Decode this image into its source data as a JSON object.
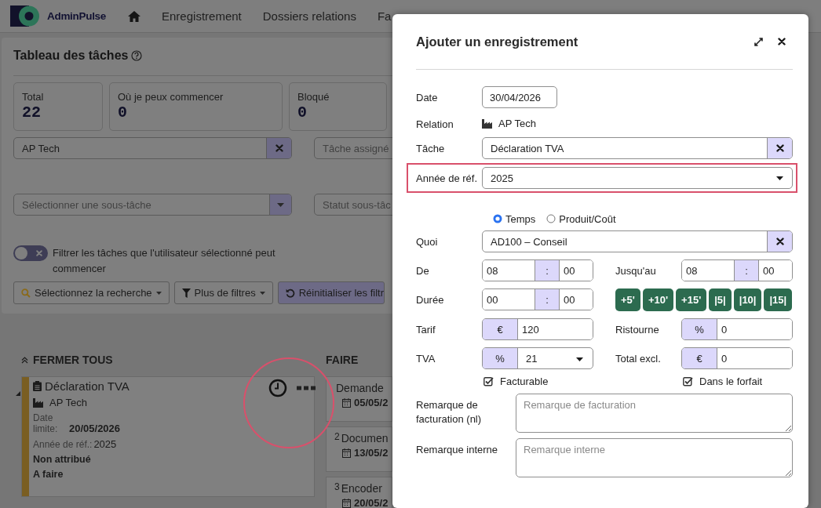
{
  "nav": {
    "brand": "AdminPulse",
    "items": [
      {
        "label": "Enregistrement"
      },
      {
        "label": "Dossiers relations"
      },
      {
        "label": "Fa"
      }
    ]
  },
  "board": {
    "title": "Tableau des tâches",
    "stats": [
      {
        "label": "Total",
        "value": "22"
      },
      {
        "label": "Où je peux commencer",
        "value": "0"
      },
      {
        "label": "Bloqué",
        "value": "0"
      }
    ],
    "filters": [
      {
        "kind": "clearable",
        "value": "AP Tech"
      },
      {
        "kind": "input",
        "placeholder": "Tâche assigné"
      },
      {
        "kind": "dropdown",
        "placeholder": "Sélectionner une sous-tâche"
      },
      {
        "kind": "input",
        "placeholder": "Statut sous-tâc"
      }
    ],
    "toggle": {
      "label": "Filtrer les tâches que l'utilisateur sélectionné peut commencer",
      "on": false
    },
    "buttons": [
      {
        "kind": "search",
        "label": "Sélectionnez la recherche"
      },
      {
        "kind": "filter",
        "label": "Plus de filtres"
      },
      {
        "kind": "reset",
        "label": "Réinitialiser les filtr"
      }
    ]
  },
  "columns": {
    "collapse_all": "FERMER TOUS",
    "column_2": "FAIRE"
  },
  "task_card": {
    "title": "Déclaration TVA",
    "relation": "AP Tech",
    "deadline_label": "Date limite:",
    "deadline": "20/05/2026",
    "year_label": "Année de réf.:",
    "year": "2025",
    "assignee": "Non attribué",
    "status": "A faire",
    "actions_highlighted": true
  },
  "subtasks": [
    {
      "title": "Demande",
      "date": "05/05/2"
    },
    {
      "number": "2",
      "title": "Documen",
      "date": "13/05/2"
    },
    {
      "number": "3",
      "title": "Encoder",
      "date": "20/05/2"
    }
  ],
  "dialog": {
    "title": "Ajouter un enregistrement",
    "date": {
      "label": "Date",
      "value": "30/04/2026"
    },
    "relation": {
      "label": "Relation",
      "value": "AP Tech"
    },
    "task": {
      "label": "Tâche",
      "value": "Déclaration TVA"
    },
    "ref_year": {
      "label": "Année de réf.",
      "value": "2025",
      "highlighted": true
    },
    "type_options": [
      {
        "label": "Temps",
        "selected": true
      },
      {
        "label": "Produit/Coût",
        "selected": false
      }
    ],
    "what": {
      "label": "Quoi",
      "value": "AD100 – Conseil"
    },
    "from": {
      "label": "De",
      "hours": "08",
      "separator": ":",
      "minutes": "00"
    },
    "until": {
      "label": "Jusqu'au",
      "hours": "08",
      "separator": ":",
      "minutes": "00"
    },
    "duration": {
      "label": "Durée",
      "hours": "00",
      "separator": ":",
      "minutes": "00"
    },
    "quick_buttons": [
      "+5'",
      "+10'",
      "+15'",
      "|5|",
      "|10|",
      "|15|"
    ],
    "rate": {
      "label": "Tarif",
      "unit": "€",
      "value": "120"
    },
    "discount": {
      "label": "Ristourne",
      "unit": "%",
      "value": "0"
    },
    "vat": {
      "label": "TVA",
      "unit": "%",
      "value": "21"
    },
    "total": {
      "label": "Total excl.",
      "unit": "€",
      "value": "0"
    },
    "checks": [
      {
        "label": "Facturable",
        "checked": true
      },
      {
        "label": "Dans le forfait",
        "checked": true
      }
    ],
    "billing_remark": {
      "label": "Remarque de facturation (nl)",
      "placeholder": "Remarque de facturation"
    },
    "internal_remark": {
      "label": "Remarque interne",
      "placeholder": "Remarque interne"
    }
  }
}
